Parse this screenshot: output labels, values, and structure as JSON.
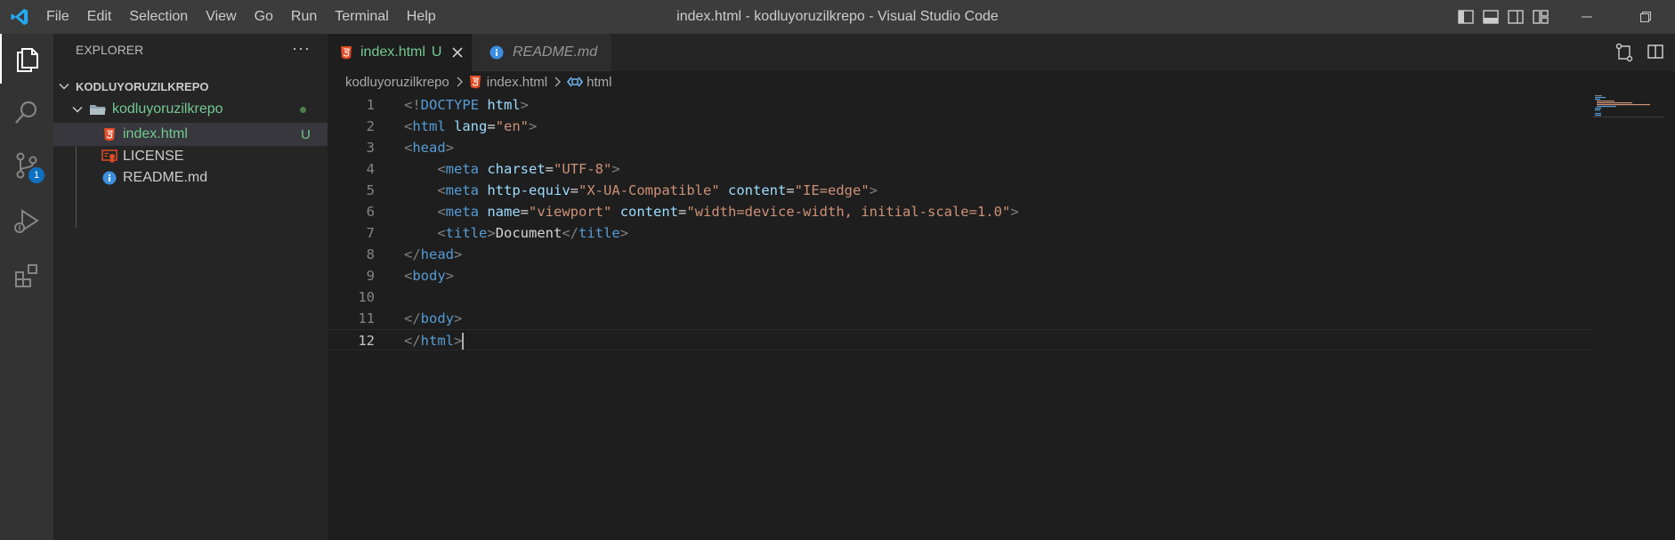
{
  "titlebar": {
    "title": "index.html - kodluyoruzilkrepo - Visual Studio Code",
    "menu": [
      "File",
      "Edit",
      "Selection",
      "View",
      "Go",
      "Run",
      "Terminal",
      "Help"
    ]
  },
  "activity_bar": {
    "items": [
      "files-icon",
      "search-icon",
      "source-control-icon",
      "run-debug-icon",
      "extensions-icon"
    ],
    "source_control_badge": "1"
  },
  "sidebar": {
    "header": "EXPLORER",
    "more": "···",
    "section_title": "KODLUYORUZILKREPO",
    "folder": {
      "name": "kodluyoruzilkrepo",
      "status_dot_color": "#4f7d4c"
    },
    "files": [
      {
        "name": "index.html",
        "badge": "U",
        "icon": "html5-icon",
        "color": "#73c991"
      },
      {
        "name": "LICENSE",
        "badge": "",
        "icon": "license-icon",
        "color": "#cccccc"
      },
      {
        "name": "README.md",
        "badge": "",
        "icon": "info-icon",
        "color": "#cccccc"
      }
    ]
  },
  "tabs": [
    {
      "label": "index.html",
      "status": "U",
      "active": true
    },
    {
      "label": "README.md",
      "status": "",
      "active": false
    }
  ],
  "breadcrumb": [
    "kodluyoruzilkrepo",
    "index.html",
    "html"
  ],
  "editor": {
    "current_line": 12,
    "lines": [
      {
        "n": "1",
        "tokens": [
          [
            "<!",
            "p"
          ],
          [
            "DOCTYPE",
            "t"
          ],
          [
            " ",
            "x"
          ],
          [
            "html",
            "a"
          ],
          [
            ">",
            "p"
          ]
        ]
      },
      {
        "n": "2",
        "tokens": [
          [
            "<",
            "p"
          ],
          [
            "html",
            "t"
          ],
          [
            " ",
            "x"
          ],
          [
            "lang",
            "a"
          ],
          [
            "=",
            "x"
          ],
          [
            "\"en\"",
            "s"
          ],
          [
            ">",
            "p"
          ]
        ]
      },
      {
        "n": "3",
        "tokens": [
          [
            "<",
            "p"
          ],
          [
            "head",
            "t"
          ],
          [
            ">",
            "p"
          ]
        ]
      },
      {
        "n": "4",
        "tokens": [
          [
            "    ",
            "x"
          ],
          [
            "<",
            "p"
          ],
          [
            "meta",
            "t"
          ],
          [
            " ",
            "x"
          ],
          [
            "charset",
            "a"
          ],
          [
            "=",
            "x"
          ],
          [
            "\"UTF-8\"",
            "s"
          ],
          [
            ">",
            "p"
          ]
        ]
      },
      {
        "n": "5",
        "tokens": [
          [
            "    ",
            "x"
          ],
          [
            "<",
            "p"
          ],
          [
            "meta",
            "t"
          ],
          [
            " ",
            "x"
          ],
          [
            "http-equiv",
            "a"
          ],
          [
            "=",
            "x"
          ],
          [
            "\"X-UA-Compatible\"",
            "s"
          ],
          [
            " ",
            "x"
          ],
          [
            "content",
            "a"
          ],
          [
            "=",
            "x"
          ],
          [
            "\"IE=edge\"",
            "s"
          ],
          [
            ">",
            "p"
          ]
        ]
      },
      {
        "n": "6",
        "tokens": [
          [
            "    ",
            "x"
          ],
          [
            "<",
            "p"
          ],
          [
            "meta",
            "t"
          ],
          [
            " ",
            "x"
          ],
          [
            "name",
            "a"
          ],
          [
            "=",
            "x"
          ],
          [
            "\"viewport\"",
            "s"
          ],
          [
            " ",
            "x"
          ],
          [
            "content",
            "a"
          ],
          [
            "=",
            "x"
          ],
          [
            "\"width=device-width, initial-scale=1.0\"",
            "s"
          ],
          [
            ">",
            "p"
          ]
        ]
      },
      {
        "n": "7",
        "tokens": [
          [
            "    ",
            "x"
          ],
          [
            "<",
            "p"
          ],
          [
            "title",
            "t"
          ],
          [
            ">",
            "p"
          ],
          [
            "Document",
            "x"
          ],
          [
            "</",
            "p"
          ],
          [
            "title",
            "t"
          ],
          [
            ">",
            "p"
          ]
        ]
      },
      {
        "n": "8",
        "tokens": [
          [
            "</",
            "p"
          ],
          [
            "head",
            "t"
          ],
          [
            ">",
            "p"
          ]
        ]
      },
      {
        "n": "9",
        "tokens": [
          [
            "<",
            "p"
          ],
          [
            "body",
            "t"
          ],
          [
            ">",
            "p"
          ]
        ]
      },
      {
        "n": "10",
        "tokens": []
      },
      {
        "n": "11",
        "tokens": [
          [
            "</",
            "p"
          ],
          [
            "body",
            "t"
          ],
          [
            ">",
            "p"
          ]
        ]
      },
      {
        "n": "12",
        "tokens": [
          [
            "</",
            "p"
          ],
          [
            "html",
            "t"
          ],
          [
            ">",
            "p"
          ]
        ]
      }
    ]
  },
  "colors": {
    "punct": "#808080",
    "tag": "#569cd6",
    "attr": "#9cdcfe",
    "string": "#ce9178",
    "text": "#d4d4d4",
    "untracked": "#73c991",
    "html_icon": "#e44d26",
    "info_icon": "#3c8fe0",
    "license_icon": "#e44d26"
  }
}
